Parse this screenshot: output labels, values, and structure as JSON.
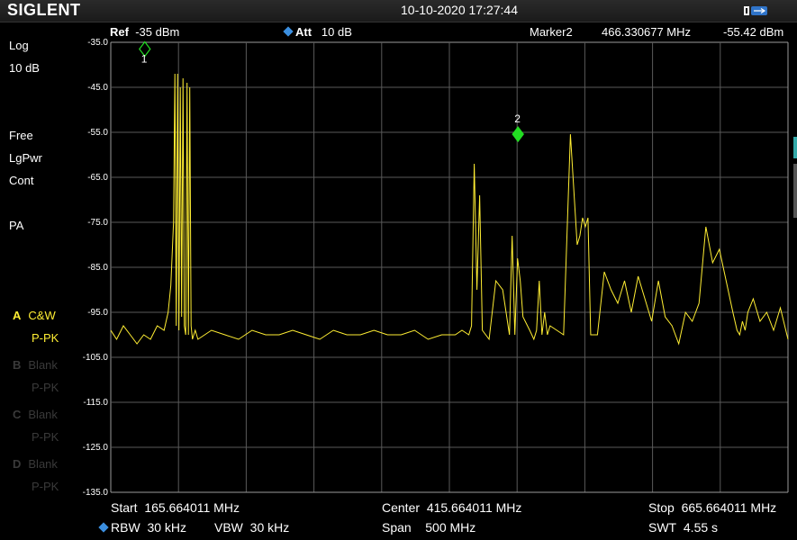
{
  "topbar": {
    "brand": "SIGLENT",
    "datetime": "10-10-2020 17:27:44",
    "battery_icon": "battery-usb-icon"
  },
  "header": {
    "ref_label": "Ref",
    "ref_value": "-35 dBm",
    "att_label": "Att",
    "att_value": "10 dB",
    "marker_label": "Marker2",
    "marker_freq": "466.330677 MHz",
    "marker_level": "-55.42 dBm"
  },
  "left_panel": {
    "scale_type": "Log",
    "scale_div": "10 dB",
    "trigger": "Free",
    "detector": "LgPwr",
    "sweep_mode": "Cont",
    "preamp": "PA",
    "traces": [
      {
        "letter": "A",
        "mode": "C&W",
        "detector": "P-PK",
        "active": true
      },
      {
        "letter": "B",
        "mode": "Blank",
        "detector": "P-PK",
        "active": false
      },
      {
        "letter": "C",
        "mode": "Blank",
        "detector": "P-PK",
        "active": false
      },
      {
        "letter": "D",
        "mode": "Blank",
        "detector": "P-PK",
        "active": false
      }
    ]
  },
  "chart_data": {
    "type": "line",
    "x_unit": "MHz",
    "y_unit": "dBm",
    "xlim": [
      165.664011,
      665.664011
    ],
    "ylim": [
      -135.0,
      -35.0
    ],
    "y_ticks": [
      "-35.0",
      "-45.0",
      "-55.0",
      "-65.0",
      "-75.0",
      "-85.0",
      "-95.0",
      "-105.0",
      "-115.0",
      "-125.0",
      "-135.0"
    ],
    "grid": true,
    "trace_color": "#ffee33",
    "series": [
      {
        "x": [
          165.66,
          170,
          175,
          180,
          185,
          190,
          195,
          200,
          205,
          208,
          210,
          212,
          213,
          214,
          215,
          216,
          217,
          218,
          219,
          220,
          221,
          222,
          223,
          224,
          225,
          226,
          227,
          228,
          229,
          230,
          235,
          240,
          250,
          260,
          270,
          280,
          290,
          300,
          310,
          320,
          330,
          340,
          350,
          360,
          370,
          380,
          390,
          400,
          410,
          420,
          425,
          430,
          432,
          434,
          436,
          438,
          440,
          445,
          450,
          455,
          460,
          462,
          464,
          466,
          468,
          470,
          475,
          478,
          480,
          482,
          484,
          486,
          488,
          490,
          495,
          500,
          505,
          510,
          512,
          514,
          516,
          518,
          520,
          525,
          530,
          535,
          540,
          545,
          550,
          555,
          560,
          565,
          570,
          575,
          580,
          585,
          590,
          595,
          600,
          605,
          610,
          615,
          620,
          625,
          628,
          630,
          632,
          634,
          636,
          640,
          645,
          650,
          655,
          660,
          665.66
        ],
        "y": [
          -99,
          -101,
          -98,
          -100,
          -102,
          -100,
          -101,
          -98,
          -99,
          -95,
          -89,
          -75,
          -42,
          -98,
          -42,
          -99,
          -45,
          -96,
          -43,
          -98,
          -100,
          -44,
          -100,
          -45,
          -98,
          -101,
          -100,
          -99,
          -100,
          -101,
          -100,
          -99,
          -100,
          -101,
          -99,
          -100,
          -100,
          -99,
          -100,
          -101,
          -99,
          -100,
          -100,
          -99,
          -100,
          -100,
          -99,
          -101,
          -100,
          -100,
          -99,
          -100,
          -98,
          -62,
          -90,
          -69,
          -99,
          -101,
          -88,
          -90,
          -100,
          -78,
          -100,
          -83,
          -88,
          -96,
          -99,
          -101,
          -99,
          -88,
          -100,
          -95,
          -100,
          -98,
          -99,
          -100,
          -55.42,
          -80,
          -78,
          -74,
          -76,
          -74,
          -100,
          -100,
          -86,
          -90,
          -93,
          -88,
          -95,
          -87,
          -92,
          -97,
          -88,
          -96,
          -98,
          -102,
          -95,
          -97,
          -93,
          -76,
          -84,
          -81,
          -88,
          -95,
          -99,
          -100,
          -97,
          -99,
          -95,
          -92,
          -97,
          -95,
          -99,
          -94,
          -101
        ]
      }
    ],
    "markers": [
      {
        "label": "1",
        "x": 190.8,
        "y": -36.5,
        "style": "hollow"
      },
      {
        "label": "2",
        "x": 466.330677,
        "y": -55.42,
        "style": "filled"
      }
    ]
  },
  "footer": {
    "start_label": "Start",
    "start_value": "165.664011 MHz",
    "center_label": "Center",
    "center_value": "415.664011 MHz",
    "stop_label": "Stop",
    "stop_value": "665.664011 MHz",
    "rbw_label": "RBW",
    "rbw_value": "30 kHz",
    "vbw_label": "VBW",
    "vbw_value": "30 kHz",
    "span_label": "Span",
    "span_value": "500 MHz",
    "swt_label": "SWT",
    "swt_value": "4.55 s"
  }
}
